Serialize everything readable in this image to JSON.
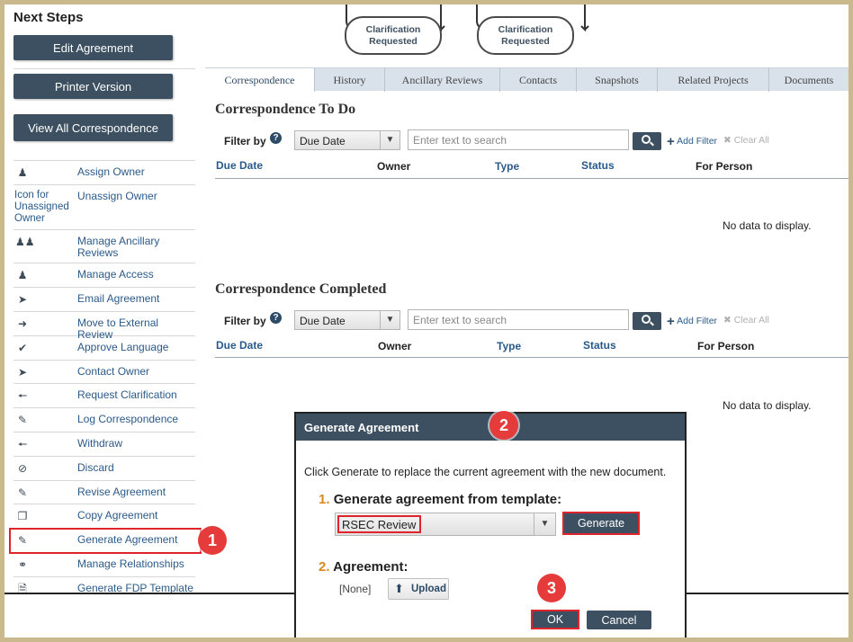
{
  "sidebar": {
    "title": "Next Steps",
    "buttons": {
      "edit_agreement": "Edit Agreement",
      "printer_version": "Printer Version",
      "view_all_correspondence": "View All Correspondence"
    },
    "steps": [
      {
        "icon": "assign-owner-icon",
        "label": "Assign Owner"
      },
      {
        "icon": "broken-image",
        "alt": "Icon for Unassigned Owner",
        "label": "Unassign Owner"
      },
      {
        "icon": "group-icon",
        "label": "Manage Ancillary Reviews"
      },
      {
        "icon": "users-icon",
        "label": "Manage Access"
      },
      {
        "icon": "paper-plane-icon",
        "label": "Email Agreement"
      },
      {
        "icon": "arrow-right-icon",
        "label": "Move to External Review"
      },
      {
        "icon": "checkmark-icon",
        "label": "Approve Language"
      },
      {
        "icon": "paper-plane-icon",
        "label": "Contact Owner"
      },
      {
        "icon": "arrow-left-icon",
        "label": "Request Clarification"
      },
      {
        "icon": "edit-icon",
        "label": "Log Correspondence"
      },
      {
        "icon": "arrow-left-icon",
        "label": "Withdraw"
      },
      {
        "icon": "prohibited-icon",
        "label": "Discard"
      },
      {
        "icon": "edit-icon",
        "label": "Revise Agreement"
      },
      {
        "icon": "copy-icon",
        "label": "Copy Agreement"
      },
      {
        "icon": "edit-icon",
        "label": "Generate Agreement"
      },
      {
        "icon": "link-icon",
        "label": "Manage Relationships"
      },
      {
        "icon": "file-icon",
        "label": "Generate FDP Template"
      }
    ]
  },
  "workflow": {
    "states": [
      "Clarification Requested",
      "Clarification Requested"
    ]
  },
  "tabs": [
    {
      "label": "Correspondence",
      "active": true
    },
    {
      "label": "History"
    },
    {
      "label": "Ancillary Reviews"
    },
    {
      "label": "Contacts"
    },
    {
      "label": "Snapshots"
    },
    {
      "label": "Related Projects"
    },
    {
      "label": "Documents"
    }
  ],
  "sections": [
    {
      "title": "Correspondence To Do",
      "filter_label": "Filter by",
      "filter_value": "Due Date",
      "search_placeholder": "Enter text to search",
      "add_filter": "Add Filter",
      "clear_all": "Clear All",
      "columns": [
        "Due Date",
        "Owner",
        "Type",
        "Status",
        "For Person"
      ],
      "empty_text": "No data to display."
    },
    {
      "title": "Correspondence Completed",
      "filter_label": "Filter by",
      "filter_value": "Due Date",
      "search_placeholder": "Enter text to search",
      "add_filter": "Add Filter",
      "clear_all": "Clear All",
      "columns": [
        "Due Date",
        "Owner",
        "Type",
        "Status",
        "For Person"
      ],
      "empty_text": "No data to display."
    }
  ],
  "dialog": {
    "title": "Generate Agreement",
    "description": "Click Generate to replace the current agreement with the new document.",
    "step1_num": "1.",
    "step1_label": "Generate agreement from template:",
    "template_value": "RSEC Review",
    "generate_label": "Generate",
    "step2_num": "2.",
    "step2_label": "Agreement:",
    "agreement_value": "[None]",
    "upload_label": "Upload",
    "ok_label": "OK",
    "cancel_label": "Cancel"
  },
  "callouts": [
    "1",
    "2",
    "3"
  ],
  "colors": {
    "accent_dark": "#3d5061",
    "link": "#2a5a8a",
    "highlight": "#e0242c",
    "callout": "#e63b3b",
    "frame": "#c9b98c"
  }
}
